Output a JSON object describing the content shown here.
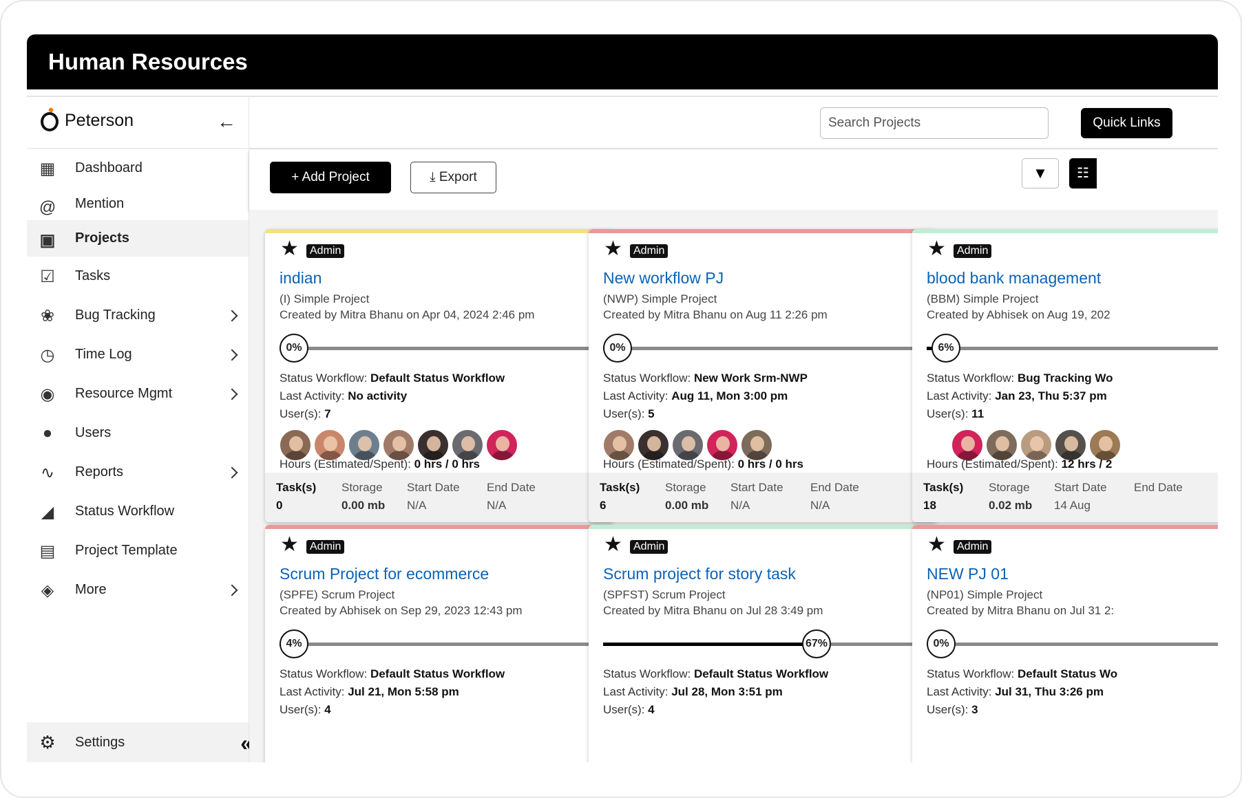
{
  "app": {
    "title": "Human Resources"
  },
  "brand": {
    "name": "Peterson"
  },
  "sidebar": {
    "items": [
      {
        "label": "Dashboard",
        "icon": "dashboard-icon",
        "chevron": false,
        "active": false
      },
      {
        "label": "Mention",
        "icon": "at-icon",
        "chevron": false,
        "active": false
      },
      {
        "label": "Projects",
        "icon": "briefcase-icon",
        "chevron": false,
        "active": true
      },
      {
        "label": "Tasks",
        "icon": "clipboard-check-icon",
        "chevron": false,
        "active": false
      },
      {
        "label": "Bug Tracking",
        "icon": "bug-icon",
        "chevron": true,
        "active": false
      },
      {
        "label": "Time Log",
        "icon": "clock-icon",
        "chevron": true,
        "active": false
      },
      {
        "label": "Resource Mgmt",
        "icon": "resource-icon",
        "chevron": true,
        "active": false
      },
      {
        "label": "Users",
        "icon": "user-icon",
        "chevron": false,
        "active": false
      },
      {
        "label": "Reports",
        "icon": "chart-line-icon",
        "chevron": true,
        "active": false
      },
      {
        "label": "Status Workflow",
        "icon": "workflow-icon",
        "chevron": false,
        "active": false
      },
      {
        "label": "Project Template",
        "icon": "template-icon",
        "chevron": false,
        "active": false
      },
      {
        "label": "More",
        "icon": "layers-icon",
        "chevron": true,
        "active": false
      }
    ],
    "settings_label": "Settings"
  },
  "header": {
    "search_placeholder": "Search Projects",
    "quick_links": "Quick Links"
  },
  "toolbar": {
    "add_project": "+ Add Project",
    "export": "⤓ Export"
  },
  "labels": {
    "status_workflow": "Status Workflow: ",
    "last_activity": "Last Activity: ",
    "users": "User(s): ",
    "hours": "Hours (Estimated/Spent): ",
    "tasks": "Task(s)",
    "storage": "Storage",
    "start_date": "Start Date",
    "end_date": "End Date",
    "admin": "Admin"
  },
  "colors": {
    "yellow": "#f2e27a",
    "red": "#e89a9a",
    "green": "#bfeed5"
  },
  "projects": [
    {
      "title": "indian",
      "type": "(I) Simple Project",
      "created": "Created by Mitra Bhanu on Apr 04, 2024 2:46 pm",
      "progress": 0,
      "progress_label": "0%",
      "workflow": "Default Status Workflow",
      "last_activity": "No activity",
      "users": "7",
      "user_count": 7,
      "hours": "0 hrs / 0 hrs",
      "tasks": "0",
      "storage": "0.00 mb",
      "start": "N/A",
      "end": "N/A",
      "color": "#f2e27a"
    },
    {
      "title": "New workflow PJ",
      "type": "(NWP) Simple Project",
      "created": "Created by Mitra Bhanu on Aug 11 2:26 pm",
      "progress": 0,
      "progress_label": "0%",
      "workflow": "New Work Srm-NWP",
      "last_activity": "Aug 11, Mon 3:00 pm",
      "users": "5",
      "user_count": 5,
      "hours": "0 hrs / 0 hrs",
      "tasks": "6",
      "storage": "0.00 mb",
      "start": "N/A",
      "end": "N/A",
      "color": "#e89a9a"
    },
    {
      "title": "blood bank management",
      "type": "(BBM) Simple Project",
      "created": "Created by Abhisek on Aug 19, 202",
      "progress": 6,
      "progress_label": "6%",
      "workflow": "Bug Tracking Wo",
      "last_activity": "Jan 23, Thu 5:37 pm",
      "users": "11",
      "user_count": 5,
      "hours": "12 hrs / 2",
      "tasks": "18",
      "storage": "0.02 mb",
      "start": "14 Aug",
      "end": "",
      "color": "#bfeed5"
    },
    {
      "title": "Scrum Project for ecommerce",
      "type": "(SPFE) Scrum Project",
      "created": "Created by Abhisek on Sep 29, 2023 12:43 pm",
      "progress": 4,
      "progress_label": "4%",
      "workflow": "Default Status Workflow",
      "last_activity": "Jul 21, Mon 5:58 pm",
      "users": "4",
      "user_count": 0,
      "hours": "",
      "tasks": "",
      "storage": "",
      "start": "",
      "end": "",
      "color": "#e89a9a"
    },
    {
      "title": "Scrum project for story task",
      "type": "(SPFST) Scrum Project",
      "created": "Created by Mitra Bhanu on Jul 28 3:49 pm",
      "progress": 67,
      "progress_label": "67%",
      "workflow": "Default Status Workflow",
      "last_activity": "Jul 28, Mon 3:51 pm",
      "users": "4",
      "user_count": 0,
      "hours": "",
      "tasks": "",
      "storage": "",
      "start": "",
      "end": "",
      "color": "#bfeed5"
    },
    {
      "title": "NEW PJ 01",
      "type": "(NP01) Simple Project",
      "created": "Created by Mitra Bhanu on Jul 31 2:",
      "progress": 0,
      "progress_label": "0%",
      "workflow": "Default Status Wo",
      "last_activity": "Jul 31, Thu 3:26 pm",
      "users": "3",
      "user_count": 0,
      "hours": "",
      "tasks": "",
      "storage": "",
      "start": "",
      "end": "",
      "color": "#e89a9a"
    }
  ]
}
